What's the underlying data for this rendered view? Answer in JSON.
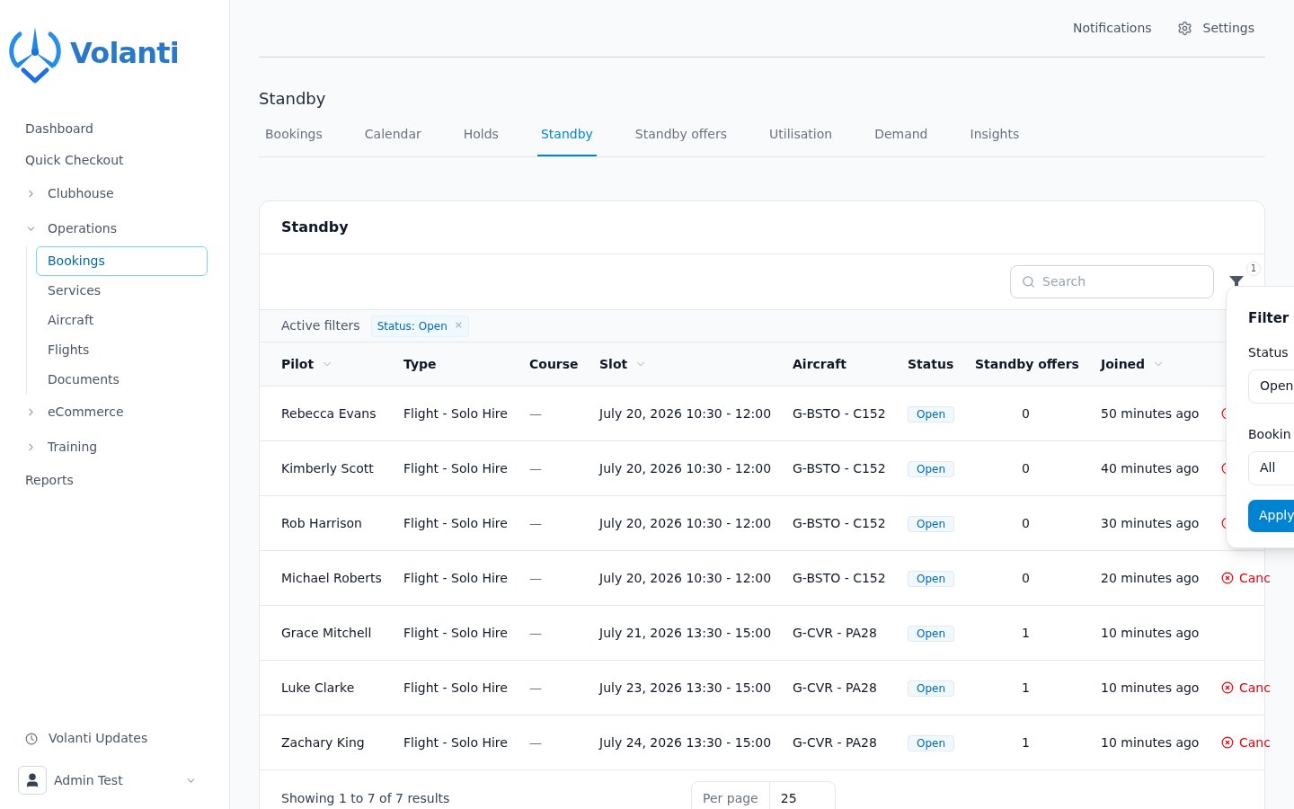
{
  "brand": {
    "name": "Volanti"
  },
  "sidebar": {
    "items": [
      {
        "label": "Dashboard",
        "kind": "link"
      },
      {
        "label": "Quick Checkout",
        "kind": "link"
      },
      {
        "label": "Clubhouse",
        "kind": "group",
        "expanded": false
      },
      {
        "label": "Operations",
        "kind": "group",
        "expanded": true,
        "children": [
          {
            "label": "Bookings",
            "selected": true
          },
          {
            "label": "Services",
            "selected": false
          },
          {
            "label": "Aircraft",
            "selected": false
          },
          {
            "label": "Flights",
            "selected": false
          },
          {
            "label": "Documents",
            "selected": false
          }
        ]
      },
      {
        "label": "eCommerce",
        "kind": "group",
        "expanded": false
      },
      {
        "label": "Training",
        "kind": "group",
        "expanded": false
      },
      {
        "label": "Reports",
        "kind": "link"
      }
    ],
    "updates": "Volanti Updates",
    "user": "Admin Test"
  },
  "topbar": {
    "notifications": "Notifications",
    "settings": "Settings"
  },
  "page_title": "Standby",
  "tabs": [
    {
      "label": "Bookings",
      "selected": false
    },
    {
      "label": "Calendar",
      "selected": false
    },
    {
      "label": "Holds",
      "selected": false
    },
    {
      "label": "Standby",
      "selected": true
    },
    {
      "label": "Standby offers",
      "selected": false
    },
    {
      "label": "Utilisation",
      "selected": false
    },
    {
      "label": "Demand",
      "selected": false
    },
    {
      "label": "Insights",
      "selected": false
    }
  ],
  "card": {
    "title": "Standby",
    "search": {
      "placeholder": "Search"
    },
    "filter_count": "1",
    "active_filters": {
      "label": "Active filters",
      "chips": [
        "Status: Open"
      ],
      "remove": "×"
    },
    "table": {
      "columns": [
        {
          "label": "Pilot",
          "sortable": true
        },
        {
          "label": "Type",
          "sortable": false
        },
        {
          "label": "Course",
          "sortable": false
        },
        {
          "label": "Slot",
          "sortable": true
        },
        {
          "label": "Aircraft",
          "sortable": false
        },
        {
          "label": "Status",
          "sortable": false
        },
        {
          "label": "Standby offers",
          "sortable": false
        },
        {
          "label": "Joined",
          "sortable": true
        }
      ],
      "rows": [
        {
          "pilot": "Rebecca Evans",
          "type": "Flight - Solo Hire",
          "course": "—",
          "slot": "July 20, 2026 10:30 - 12:00",
          "aircraft": "G-BSTO - C152",
          "status": "Open",
          "offers": "0",
          "joined": "50 minutes ago",
          "action": {
            "icon": true
          }
        },
        {
          "pilot": "Kimberly Scott",
          "type": "Flight - Solo Hire",
          "course": "—",
          "slot": "July 20, 2026 10:30 - 12:00",
          "aircraft": "G-BSTO - C152",
          "status": "Open",
          "offers": "0",
          "joined": "40 minutes ago",
          "action": {
            "icon": true
          }
        },
        {
          "pilot": "Rob Harrison",
          "type": "Flight - Solo Hire",
          "course": "—",
          "slot": "July 20, 2026 10:30 - 12:00",
          "aircraft": "G-BSTO - C152",
          "status": "Open",
          "offers": "0",
          "joined": "30 minutes ago",
          "action": {
            "icon": true
          }
        },
        {
          "pilot": "Michael Roberts",
          "type": "Flight - Solo Hire",
          "course": "—",
          "slot": "July 20, 2026 10:30 - 12:00",
          "aircraft": "G-BSTO - C152",
          "status": "Open",
          "offers": "0",
          "joined": "20 minutes ago",
          "action": {
            "icon": true,
            "label": "Canc"
          }
        },
        {
          "pilot": "Grace Mitchell",
          "type": "Flight - Solo Hire",
          "course": "—",
          "slot": "July 21, 2026 13:30 - 15:00",
          "aircraft": "G-CVR - PA28",
          "status": "Open",
          "offers": "1",
          "joined": "10 minutes ago"
        },
        {
          "pilot": "Luke Clarke",
          "type": "Flight - Solo Hire",
          "course": "—",
          "slot": "July 23, 2026 13:30 - 15:00",
          "aircraft": "G-CVR - PA28",
          "status": "Open",
          "offers": "1",
          "joined": "10 minutes ago",
          "action": {
            "icon": true,
            "label": "Canc"
          }
        },
        {
          "pilot": "Zachary King",
          "type": "Flight - Solo Hire",
          "course": "—",
          "slot": "July 24, 2026 13:30 - 15:00",
          "aircraft": "G-CVR - PA28",
          "status": "Open",
          "offers": "1",
          "joined": "10 minutes ago",
          "action": {
            "icon": true,
            "label": "Canc"
          }
        }
      ]
    },
    "footer": {
      "summary": "Showing 1 to 7 of 7 results",
      "per_page_label": "Per page",
      "per_page": "25"
    }
  },
  "filters_popover": {
    "title": "Filter",
    "status_label": "Status",
    "status_value": "Open",
    "booking_label": "Bookin",
    "booking_value": "All",
    "apply": "Apply"
  }
}
